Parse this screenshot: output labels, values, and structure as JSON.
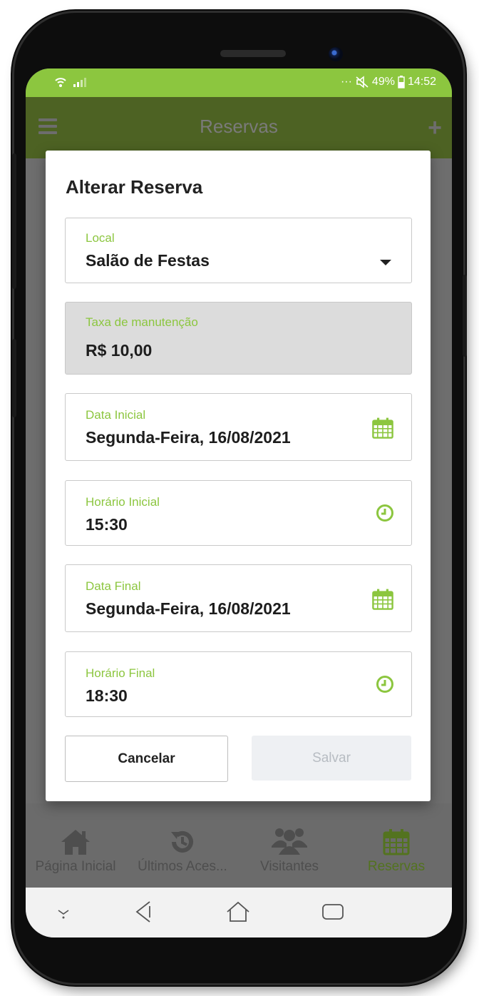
{
  "status_bar": {
    "battery": "49%",
    "time": "14:52",
    "dots": "···"
  },
  "app_bar": {
    "title": "Reservas"
  },
  "dialog": {
    "title": "Alterar Reserva",
    "fields": [
      {
        "label": "Local",
        "value": "Salão de Festas"
      },
      {
        "label": "Taxa de manutenção",
        "value": "R$ 10,00"
      },
      {
        "label": "Data Inicial",
        "value": "Segunda-Feira, 16/08/2021"
      },
      {
        "label": "Horário Inicial",
        "value": "15:30"
      },
      {
        "label": "Data Final",
        "value": "Segunda-Feira, 16/08/2021"
      },
      {
        "label": "Horário Final",
        "value": "18:30"
      }
    ],
    "cancel_label": "Cancelar",
    "save_label": "Salvar"
  },
  "tabs": [
    {
      "label": "Página Inicial",
      "icon": "home-icon"
    },
    {
      "label": "Últimos Aces...",
      "icon": "history-icon"
    },
    {
      "label": "Visitantes",
      "icon": "users-icon"
    },
    {
      "label": "Reservas",
      "icon": "calendar-icon",
      "active": true
    }
  ],
  "colors": {
    "accent": "#8cc63f",
    "app_bar_dimmed": "#4d6223",
    "active_tab": "#53731f"
  }
}
